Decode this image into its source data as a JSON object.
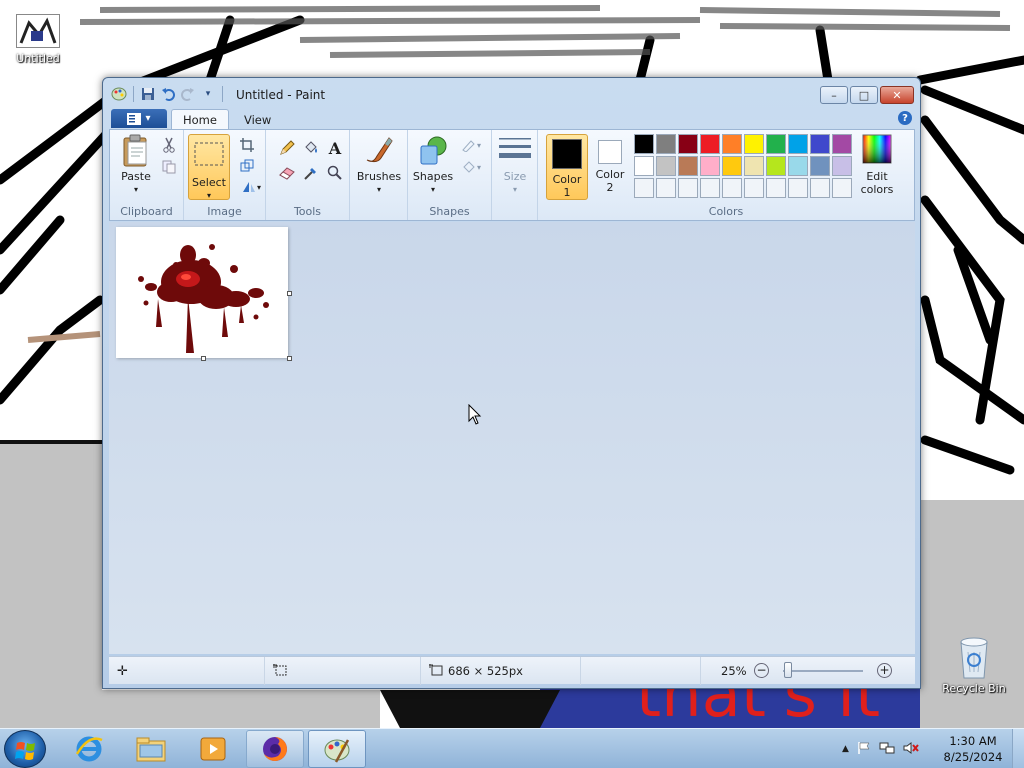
{
  "desktop": {
    "icons": [
      {
        "label": "Untitled",
        "icon": "paint-image-icon"
      },
      {
        "label": "Recycle Bin",
        "icon": "recycle-bin-icon"
      }
    ],
    "wallpaper_text": "that's it",
    "wallpaper_text_color": "#e0201c"
  },
  "window": {
    "title": "Untitled - Paint",
    "controls": {
      "minimize": "–",
      "maximize": "□",
      "close": "✕"
    }
  },
  "ribbon": {
    "tabs": [
      {
        "label": "Home",
        "active": true
      },
      {
        "label": "View",
        "active": false
      }
    ],
    "groups": {
      "clipboard": {
        "label": "Clipboard",
        "paste": "Paste"
      },
      "image": {
        "label": "Image",
        "select": "Select"
      },
      "tools": {
        "label": "Tools"
      },
      "brushes": {
        "label": "Brushes"
      },
      "shapes": {
        "label": "Shapes",
        "shapes_btn": "Shapes"
      },
      "size": {
        "label": "Size"
      },
      "colors": {
        "label": "Colors",
        "color1": "Color 1",
        "color1_line1": "Color",
        "color1_line2": "1",
        "color2_line1": "Color",
        "color2_line2": "2",
        "edit_line1": "Edit",
        "edit_line2": "colors",
        "color1_value": "#000000",
        "color2_value": "#ffffff",
        "palette_row1": [
          "#000000",
          "#7f7f7f",
          "#880015",
          "#ed1c24",
          "#ff7f27",
          "#fff200",
          "#22b14c",
          "#00a2e8",
          "#3f48cc",
          "#a349a4"
        ],
        "palette_row2": [
          "#ffffff",
          "#c3c3c3",
          "#b97a57",
          "#ffaec9",
          "#ffc90e",
          "#efe4b0",
          "#b5e61d",
          "#99d9ea",
          "#7092be",
          "#c8bfe7"
        ]
      }
    }
  },
  "statusbar": {
    "image_size": "686 × 525px",
    "zoom": "25%",
    "zoom_level": 0.25
  },
  "taskbar": {
    "clock_time": "1:30 AM",
    "clock_date": "8/25/2024",
    "pinned": [
      "internet-explorer-icon",
      "file-explorer-icon",
      "media-player-icon",
      "firefox-icon",
      "paint-icon"
    ]
  }
}
